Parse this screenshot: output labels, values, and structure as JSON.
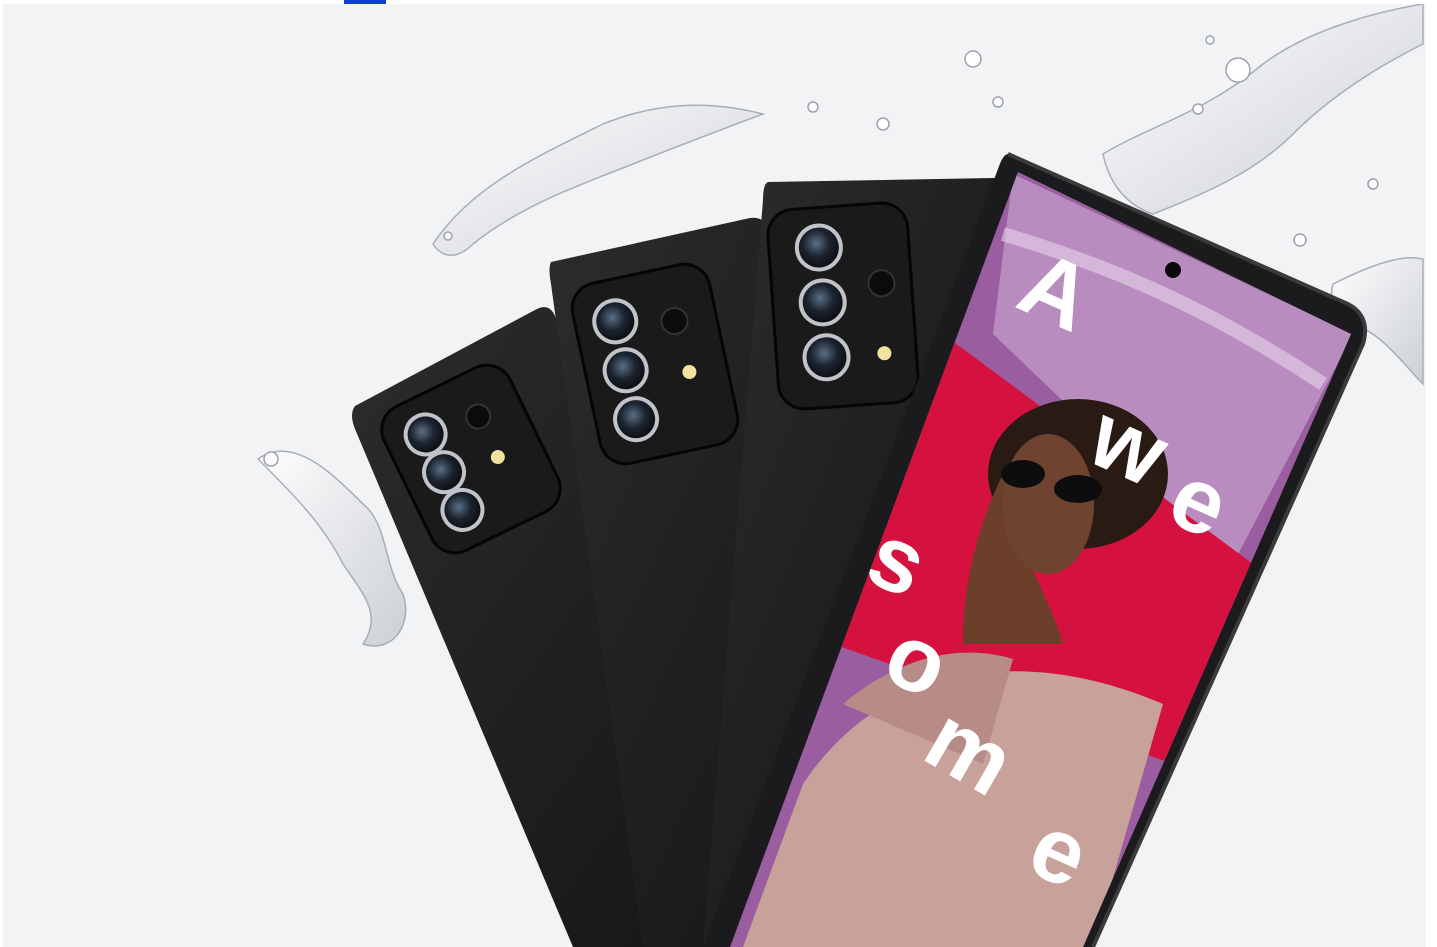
{
  "top_link": {
    "label": ""
  },
  "hero": {
    "screen_text": [
      "A",
      "w",
      "e",
      "s",
      "o",
      "m",
      "e"
    ],
    "colors": {
      "background": "#f2f3f5",
      "phone_body": "#1d1d1f",
      "screen_purple": "#9a5ea0",
      "screen_red": "#d5123f",
      "sweater": "#c9a19b"
    }
  }
}
